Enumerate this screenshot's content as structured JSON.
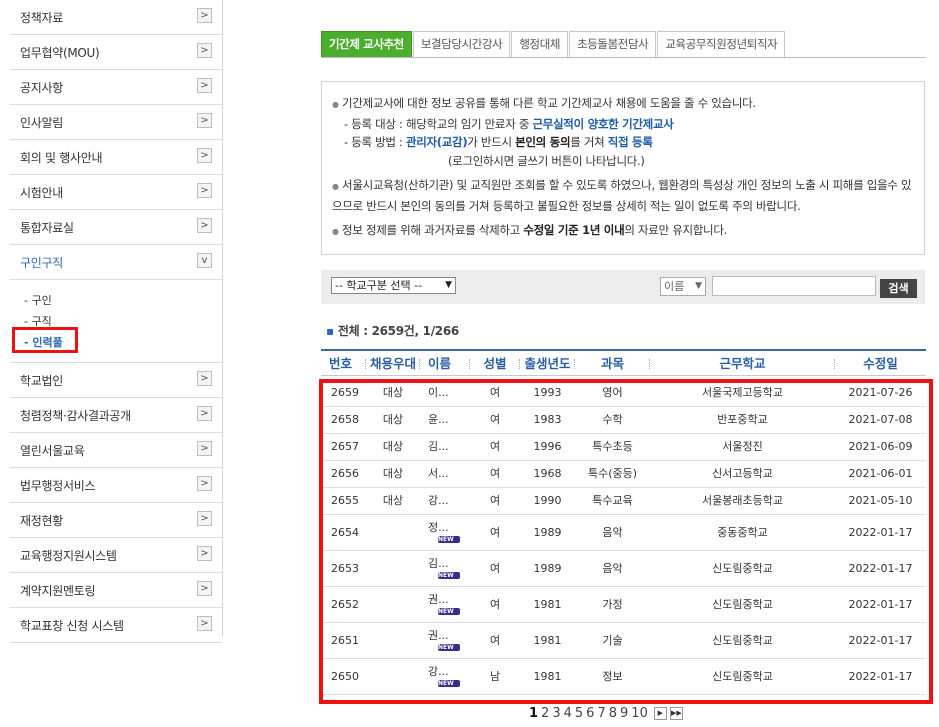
{
  "sidebar": {
    "items_top": [
      {
        "label": "정책자료"
      },
      {
        "label": "업무협약(MOU)"
      },
      {
        "label": "공지사항"
      },
      {
        "label": "인사알림"
      },
      {
        "label": "회의 및 행사안내"
      },
      {
        "label": "시험안내"
      },
      {
        "label": "통합자료실"
      },
      {
        "label": "구인구직"
      }
    ],
    "submenu": [
      {
        "label": "- 구인"
      },
      {
        "label": "- 구직"
      },
      {
        "label": "- 인력풀"
      }
    ],
    "items_bottom": [
      {
        "label": "학교법인"
      },
      {
        "label": "청렴정책·감사결과공개"
      },
      {
        "label": "열린서울교육"
      },
      {
        "label": "법무행정서비스"
      },
      {
        "label": "재정현황"
      },
      {
        "label": "교육행정지원시스템"
      },
      {
        "label": "계약지원멘토링"
      },
      {
        "label": "학교표창 신청 시스템"
      }
    ],
    "arrow_right": ">",
    "arrow_down": "v"
  },
  "tabs": [
    "기간제 교사추천",
    "보결담당시간강사",
    "행정대체",
    "초등돌봄전담사",
    "교육공무직원정년퇴직자"
  ],
  "info": {
    "line1": "기간제교사에 대한 정보 공유를 통해 다른 학교 기간제교사 채용에 도움을 줄 수 있습니다.",
    "l2_prefix": "- 등록 대상 : 해당학교의 임기 만료자 중 ",
    "l2_bold": "근무실적이 양호한 기간제교사",
    "l3_prefix": "- 등록 방법 : ",
    "l3_b1": "관리자(교감)",
    "l3_mid": "가 반드시 ",
    "l3_b2": "본인의 동의",
    "l3_mid2": "를 거쳐 ",
    "l3_b3": "직접 등록",
    "l4": "(로그인하시면 글쓰기 버튼이 나타납니다.)",
    "para2": "서울시교육청(산하기관) 및 교직원만 조회를 할 수 있도록 하였으나, 웹환경의 특성상 개인 정보의 노출 시 피해를 입을수 있으므로 반드시 본인의 동의를 거쳐 등록하고 불필요한 정보를 상세히 적는 일이 없도록 주의 바랍니다.",
    "para3_prefix": "정보 정제를 위해 과거자료를 삭제하고 ",
    "para3_bold": "수정일 기준 1년 이내",
    "para3_suffix": "의 자료만 유지합니다.",
    "bullet": "●"
  },
  "search": {
    "school_select": "-- 학교구분 선택 --",
    "field_select": "이름",
    "button": "검색"
  },
  "total": {
    "bullet": "▪",
    "text": "전체 : 2659건, 1/266"
  },
  "table": {
    "headers": [
      "번호",
      "채용우대",
      "이름",
      "성별",
      "출생년도",
      "과목",
      "근무학교",
      "수정일"
    ],
    "new_label": "NEW",
    "rows": [
      {
        "no": "2659",
        "pref": "대상",
        "name": "이...",
        "sex": "여",
        "year": "1993",
        "subject": "영어",
        "school": "서울국제고등학교",
        "date": "2021-07-26",
        "new": false
      },
      {
        "no": "2658",
        "pref": "대상",
        "name": "윤...",
        "sex": "여",
        "year": "1983",
        "subject": "수학",
        "school": "반포중학교",
        "date": "2021-07-08",
        "new": false
      },
      {
        "no": "2657",
        "pref": "대상",
        "name": "김...",
        "sex": "여",
        "year": "1996",
        "subject": "특수초등",
        "school": "서울정진",
        "date": "2021-06-09",
        "new": false
      },
      {
        "no": "2656",
        "pref": "대상",
        "name": "서...",
        "sex": "여",
        "year": "1968",
        "subject": "특수(중등)",
        "school": "신서고등학교",
        "date": "2021-06-01",
        "new": false
      },
      {
        "no": "2655",
        "pref": "대상",
        "name": "강...",
        "sex": "여",
        "year": "1990",
        "subject": "특수교육",
        "school": "서울봉래초등학교",
        "date": "2021-05-10",
        "new": false
      },
      {
        "no": "2654",
        "pref": "",
        "name": "정...",
        "sex": "여",
        "year": "1989",
        "subject": "음악",
        "school": "중동중학교",
        "date": "2022-01-17",
        "new": true
      },
      {
        "no": "2653",
        "pref": "",
        "name": "김...",
        "sex": "여",
        "year": "1989",
        "subject": "음악",
        "school": "신도림중학교",
        "date": "2022-01-17",
        "new": true
      },
      {
        "no": "2652",
        "pref": "",
        "name": "권...",
        "sex": "여",
        "year": "1981",
        "subject": "가정",
        "school": "신도림중학교",
        "date": "2022-01-17",
        "new": true
      },
      {
        "no": "2651",
        "pref": "",
        "name": "권...",
        "sex": "여",
        "year": "1981",
        "subject": "기술",
        "school": "신도림중학교",
        "date": "2022-01-17",
        "new": true
      },
      {
        "no": "2650",
        "pref": "",
        "name": "강...",
        "sex": "남",
        "year": "1981",
        "subject": "정보",
        "school": "신도림중학교",
        "date": "2022-01-17",
        "new": true
      }
    ]
  },
  "pager": {
    "pages": [
      "1",
      "2",
      "3",
      "4",
      "5",
      "6",
      "7",
      "8",
      "9",
      "10"
    ],
    "next": "▶",
    "last": "▶▶"
  }
}
